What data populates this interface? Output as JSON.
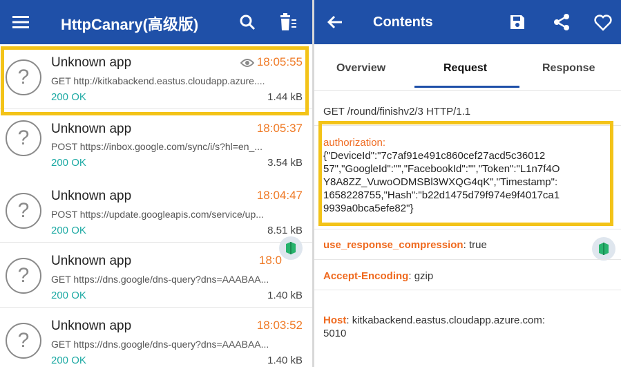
{
  "left_app": {
    "title": "HttpCanary(高级版)",
    "menu_icon": "hamburger-menu-icon",
    "search_icon": "search-icon",
    "clear_icon": "trash-filter-icon"
  },
  "requests": [
    {
      "app": "Unknown app",
      "time": "18:05:55",
      "url": "GET http://kitkabackend.eastus.cloudapp.azure....",
      "status": "200 OK",
      "size": "1.44 kB",
      "viewed": true
    },
    {
      "app": "Unknown app",
      "time": "18:05:37",
      "url": "POST https://inbox.google.com/sync/i/s?hl=en_...",
      "status": "200 OK",
      "size": "3.54 kB",
      "viewed": false
    },
    {
      "app": "Unknown app",
      "time": "18:04:47",
      "url": "POST https://update.googleapis.com/service/up...",
      "status": "200 OK",
      "size": "8.51 kB",
      "viewed": false
    },
    {
      "app": "Unknown app",
      "time": "18:0",
      "url": "GET https://dns.google/dns-query?dns=AAABAA...",
      "status": "200 OK",
      "size": "1.40 kB",
      "viewed": false
    },
    {
      "app": "Unknown app",
      "time": "18:03:52",
      "url": "GET https://dns.google/dns-query?dns=AAABAA...",
      "status": "200 OK",
      "size": "1.40 kB",
      "viewed": false
    }
  ],
  "right_app": {
    "title": "Contents",
    "back_icon": "back-arrow-icon",
    "save_icon": "save-icon",
    "share_icon": "share-icon",
    "favorite_icon": "heart-icon"
  },
  "tabs": [
    "Overview",
    "Request",
    "Response"
  ],
  "active_tab": "Request",
  "request_line": "GET /round/finishv2/3 HTTP/1.1",
  "headers": [
    {
      "key": "authorization:",
      "value": "{\"DeviceId\":\"7c7af91e491c860cef27acd5c36012\n57\",\"GoogleId\":\"\",\"FacebookId\":\"\",\"Token\":\"L1n7f4O\nY8A8ZZ_VuwoODMSBl3WXQG4qK\",\"Timestamp\":\n1658228755,\"Hash\":\"b22d1475d79f974e9f4017ca1\n9939a0bca5efe82\"}"
    },
    {
      "key": "use_response_compression",
      "value": "true"
    },
    {
      "key": "Accept-Encoding",
      "value": "gzip"
    },
    {
      "key": "Host",
      "value": "kitkabackend.eastus.cloudapp.azure.com:\n5010"
    }
  ],
  "colors": {
    "appbar": "#1f50a8",
    "time": "#ef7a26",
    "status": "#1eaaa4",
    "header_key": "#ef6a1f",
    "highlight": "#f3c318"
  }
}
